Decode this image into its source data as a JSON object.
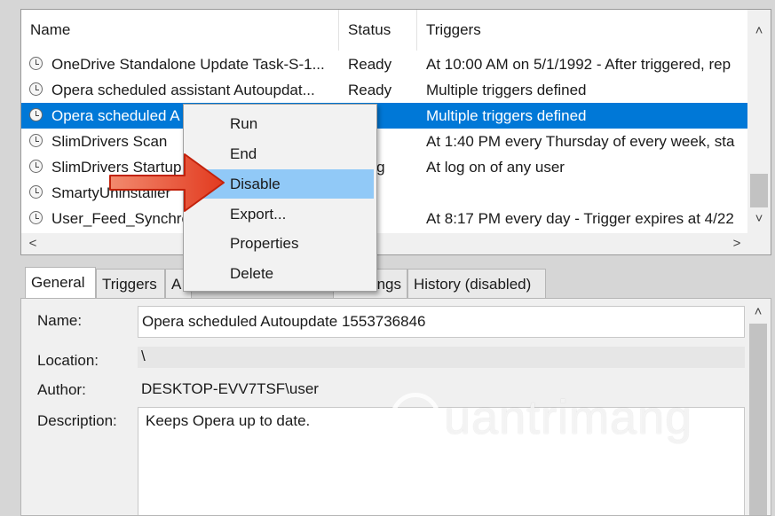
{
  "task_list": {
    "columns": {
      "name": "Name",
      "status": "Status",
      "triggers": "Triggers"
    },
    "rows": [
      {
        "name": "OneDrive Standalone Update Task-S-1...",
        "status": "Ready",
        "triggers": "At 10:00 AM on 5/1/1992 - After triggered, rep"
      },
      {
        "name": "Opera scheduled assistant Autoupdat...",
        "status": "Ready",
        "triggers": "Multiple triggers defined"
      },
      {
        "name": "Opera scheduled A",
        "status": "ady",
        "triggers": "Multiple triggers defined",
        "selected": true
      },
      {
        "name": "SlimDrivers Scan",
        "status": "ady",
        "triggers": "At 1:40 PM every Thursday of every week, sta"
      },
      {
        "name": "SlimDrivers Startup",
        "status": "nning",
        "triggers": "At log on of any user"
      },
      {
        "name": "SmartyUninstaller",
        "status": "ady",
        "triggers": ""
      },
      {
        "name": "User_Feed_Synchro",
        "status": "ady",
        "triggers": "At 8:17 PM every day - Trigger expires at 4/22"
      }
    ]
  },
  "context_menu": {
    "items": [
      "Run",
      "End",
      "Disable",
      "Export...",
      "Properties",
      "Delete"
    ],
    "highlighted": "Disable"
  },
  "tabs": [
    "General",
    "Triggers",
    "A",
    "ngs",
    "History (disabled)"
  ],
  "details": {
    "name_label": "Name:",
    "name_value": "Opera scheduled Autoupdate 1553736846",
    "location_label": "Location:",
    "location_value": "\\",
    "author_label": "Author:",
    "author_value": "DESKTOP-EVV7TSF\\user",
    "description_label": "Description:",
    "description_value": "Keeps Opera up to date."
  },
  "watermark": "uantrimang",
  "colors": {
    "selection": "#0078d7",
    "menu_hover": "#91c9f7",
    "arrow": "#e8452b"
  }
}
